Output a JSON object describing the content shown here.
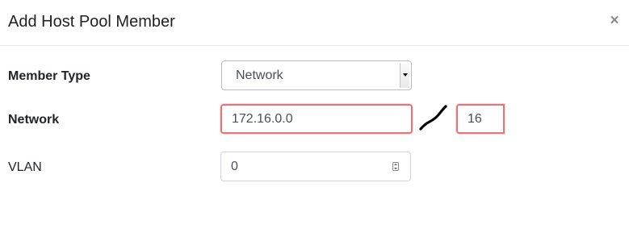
{
  "dialog": {
    "title": "Add Host Pool Member",
    "close_label": "×"
  },
  "form": {
    "member_type": {
      "label": "Member Type",
      "selected": "Network"
    },
    "network": {
      "label": "Network",
      "address": "172.16.0.0",
      "separator": "/",
      "prefix_length": "16",
      "invalid_color": "#e4767a"
    },
    "vlan": {
      "label": "VLAN",
      "value": "0"
    }
  }
}
